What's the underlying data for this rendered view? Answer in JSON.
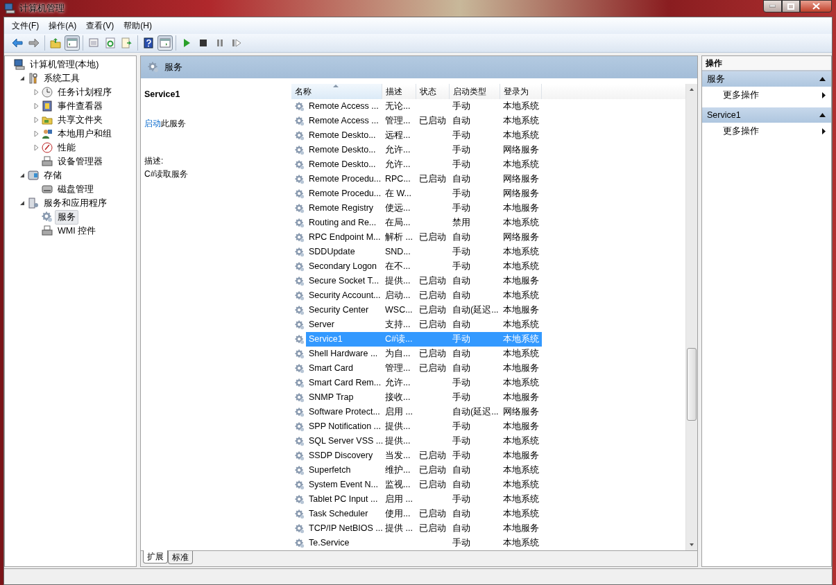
{
  "window": {
    "title": "计算机管理"
  },
  "menu": [
    {
      "label": "文件(F)"
    },
    {
      "label": "操作(A)"
    },
    {
      "label": "查看(V)"
    },
    {
      "label": "帮助(H)"
    }
  ],
  "toolbar": [
    [
      {
        "kind": "back",
        "pressed": false
      },
      {
        "kind": "forward",
        "pressed": false
      }
    ],
    [
      {
        "kind": "up",
        "pressed": false
      },
      {
        "kind": "console-tree",
        "pressed": true
      }
    ],
    [
      {
        "kind": "properties",
        "pressed": false
      },
      {
        "kind": "refresh",
        "pressed": false
      },
      {
        "kind": "export",
        "pressed": false
      }
    ],
    [
      {
        "kind": "help",
        "pressed": false
      },
      {
        "kind": "action-pane",
        "pressed": true
      }
    ],
    [
      {
        "kind": "play",
        "pressed": false
      },
      {
        "kind": "stop",
        "pressed": false
      },
      {
        "kind": "pause",
        "pressed": false
      },
      {
        "kind": "resume",
        "pressed": false
      }
    ]
  ],
  "tree": [
    {
      "label": "计算机管理(本地)",
      "kind": "computer",
      "selected": false,
      "children": [
        {
          "label": "系统工具",
          "kind": "tools",
          "selected": false,
          "expanded": true,
          "children": [
            {
              "label": "任务计划程序",
              "kind": "clock",
              "selected": false,
              "expanded": false
            },
            {
              "label": "事件查看器",
              "kind": "event-log",
              "selected": false,
              "expanded": false
            },
            {
              "label": "共享文件夹",
              "kind": "folder",
              "selected": false,
              "expanded": false
            },
            {
              "label": "本地用户和组",
              "kind": "users",
              "selected": false,
              "expanded": false
            },
            {
              "label": "性能",
              "kind": "performance",
              "selected": false,
              "expanded": false
            },
            {
              "label": "设备管理器",
              "kind": "device",
              "selected": false
            }
          ]
        },
        {
          "label": "存储",
          "kind": "storage",
          "selected": false,
          "expanded": true,
          "children": [
            {
              "label": "磁盘管理",
              "kind": "disk",
              "selected": false
            }
          ]
        },
        {
          "label": "服务和应用程序",
          "kind": "server",
          "selected": false,
          "expanded": true,
          "children": [
            {
              "label": "服务",
              "kind": "gear",
              "selected": true
            },
            {
              "label": "WMI 控件",
              "kind": "device",
              "selected": false
            }
          ]
        }
      ]
    }
  ],
  "center": {
    "title": "服务",
    "detail": {
      "name": "Service1",
      "action_link": "启动",
      "action_text": "此服务",
      "description_label": "描述:",
      "description": "C#读取服务"
    },
    "columns": [
      {
        "label": "名称",
        "sorted": true
      },
      {
        "label": "描述",
        "sorted": false
      },
      {
        "label": "状态",
        "sorted": false
      },
      {
        "label": "启动类型",
        "sorted": false
      },
      {
        "label": "登录为",
        "sorted": false
      }
    ],
    "rows": [
      {
        "name": "Remote Access ...",
        "description": "无论...",
        "status": "",
        "startup": "手动",
        "logon": "本地系统",
        "selected": false
      },
      {
        "name": "Remote Access ...",
        "description": "管理...",
        "status": "已启动",
        "startup": "自动",
        "logon": "本地系统",
        "selected": false
      },
      {
        "name": "Remote Deskto...",
        "description": "远程...",
        "status": "",
        "startup": "手动",
        "logon": "本地系统",
        "selected": false
      },
      {
        "name": "Remote Deskto...",
        "description": "允许...",
        "status": "",
        "startup": "手动",
        "logon": "网络服务",
        "selected": false
      },
      {
        "name": "Remote Deskto...",
        "description": "允许...",
        "status": "",
        "startup": "手动",
        "logon": "本地系统",
        "selected": false
      },
      {
        "name": "Remote Procedu...",
        "description": "RPC...",
        "status": "已启动",
        "startup": "自动",
        "logon": "网络服务",
        "selected": false
      },
      {
        "name": "Remote Procedu...",
        "description": "在 W...",
        "status": "",
        "startup": "手动",
        "logon": "网络服务",
        "selected": false
      },
      {
        "name": "Remote Registry",
        "description": "使远...",
        "status": "",
        "startup": "手动",
        "logon": "本地服务",
        "selected": false
      },
      {
        "name": "Routing and Re...",
        "description": "在局...",
        "status": "",
        "startup": "禁用",
        "logon": "本地系统",
        "selected": false
      },
      {
        "name": "RPC Endpoint M...",
        "description": "解析 ...",
        "status": "已启动",
        "startup": "自动",
        "logon": "网络服务",
        "selected": false
      },
      {
        "name": "SDDUpdate",
        "description": "SND...",
        "status": "",
        "startup": "手动",
        "logon": "本地系统",
        "selected": false
      },
      {
        "name": "Secondary Logon",
        "description": "在不...",
        "status": "",
        "startup": "手动",
        "logon": "本地系统",
        "selected": false
      },
      {
        "name": "Secure Socket T...",
        "description": "提供...",
        "status": "已启动",
        "startup": "自动",
        "logon": "本地服务",
        "selected": false
      },
      {
        "name": "Security Account...",
        "description": "启动...",
        "status": "已启动",
        "startup": "自动",
        "logon": "本地系统",
        "selected": false
      },
      {
        "name": "Security Center",
        "description": "WSC...",
        "status": "已启动",
        "startup": "自动(延迟...",
        "logon": "本地服务",
        "selected": false
      },
      {
        "name": "Server",
        "description": "支持...",
        "status": "已启动",
        "startup": "自动",
        "logon": "本地系统",
        "selected": false
      },
      {
        "name": "Service1",
        "description": "C#读...",
        "status": "",
        "startup": "手动",
        "logon": "本地系统",
        "selected": true
      },
      {
        "name": "Shell Hardware ...",
        "description": "为自...",
        "status": "已启动",
        "startup": "自动",
        "logon": "本地系统",
        "selected": false
      },
      {
        "name": "Smart Card",
        "description": "管理...",
        "status": "已启动",
        "startup": "自动",
        "logon": "本地服务",
        "selected": false
      },
      {
        "name": "Smart Card Rem...",
        "description": "允许...",
        "status": "",
        "startup": "手动",
        "logon": "本地系统",
        "selected": false
      },
      {
        "name": "SNMP Trap",
        "description": "接收...",
        "status": "",
        "startup": "手动",
        "logon": "本地服务",
        "selected": false
      },
      {
        "name": "Software Protect...",
        "description": "启用 ...",
        "status": "",
        "startup": "自动(延迟...",
        "logon": "网络服务",
        "selected": false
      },
      {
        "name": "SPP Notification ...",
        "description": "提供...",
        "status": "",
        "startup": "手动",
        "logon": "本地服务",
        "selected": false
      },
      {
        "name": "SQL Server VSS ...",
        "description": "提供...",
        "status": "",
        "startup": "手动",
        "logon": "本地系统",
        "selected": false
      },
      {
        "name": "SSDP Discovery",
        "description": "当发...",
        "status": "已启动",
        "startup": "手动",
        "logon": "本地服务",
        "selected": false
      },
      {
        "name": "Superfetch",
        "description": "维护...",
        "status": "已启动",
        "startup": "自动",
        "logon": "本地系统",
        "selected": false
      },
      {
        "name": "System Event N...",
        "description": "监视...",
        "status": "已启动",
        "startup": "自动",
        "logon": "本地系统",
        "selected": false
      },
      {
        "name": "Tablet PC Input ...",
        "description": "启用 ...",
        "status": "",
        "startup": "手动",
        "logon": "本地系统",
        "selected": false
      },
      {
        "name": "Task Scheduler",
        "description": "使用...",
        "status": "已启动",
        "startup": "自动",
        "logon": "本地系统",
        "selected": false
      },
      {
        "name": "TCP/IP NetBIOS ...",
        "description": "提供 ...",
        "status": "已启动",
        "startup": "自动",
        "logon": "本地服务",
        "selected": false
      },
      {
        "name": "Te.Service",
        "description": "",
        "status": "",
        "startup": "手动",
        "logon": "本地系统",
        "selected": false
      }
    ],
    "tabs": [
      {
        "label": "扩展",
        "selected": true
      },
      {
        "label": "标准",
        "selected": false
      }
    ]
  },
  "actions": {
    "title": "操作",
    "sections": [
      {
        "title": "服务",
        "expanded": true,
        "items": [
          {
            "label": "更多操作"
          }
        ]
      },
      {
        "title": "Service1",
        "expanded": true,
        "items": [
          {
            "label": "更多操作"
          }
        ]
      }
    ]
  }
}
